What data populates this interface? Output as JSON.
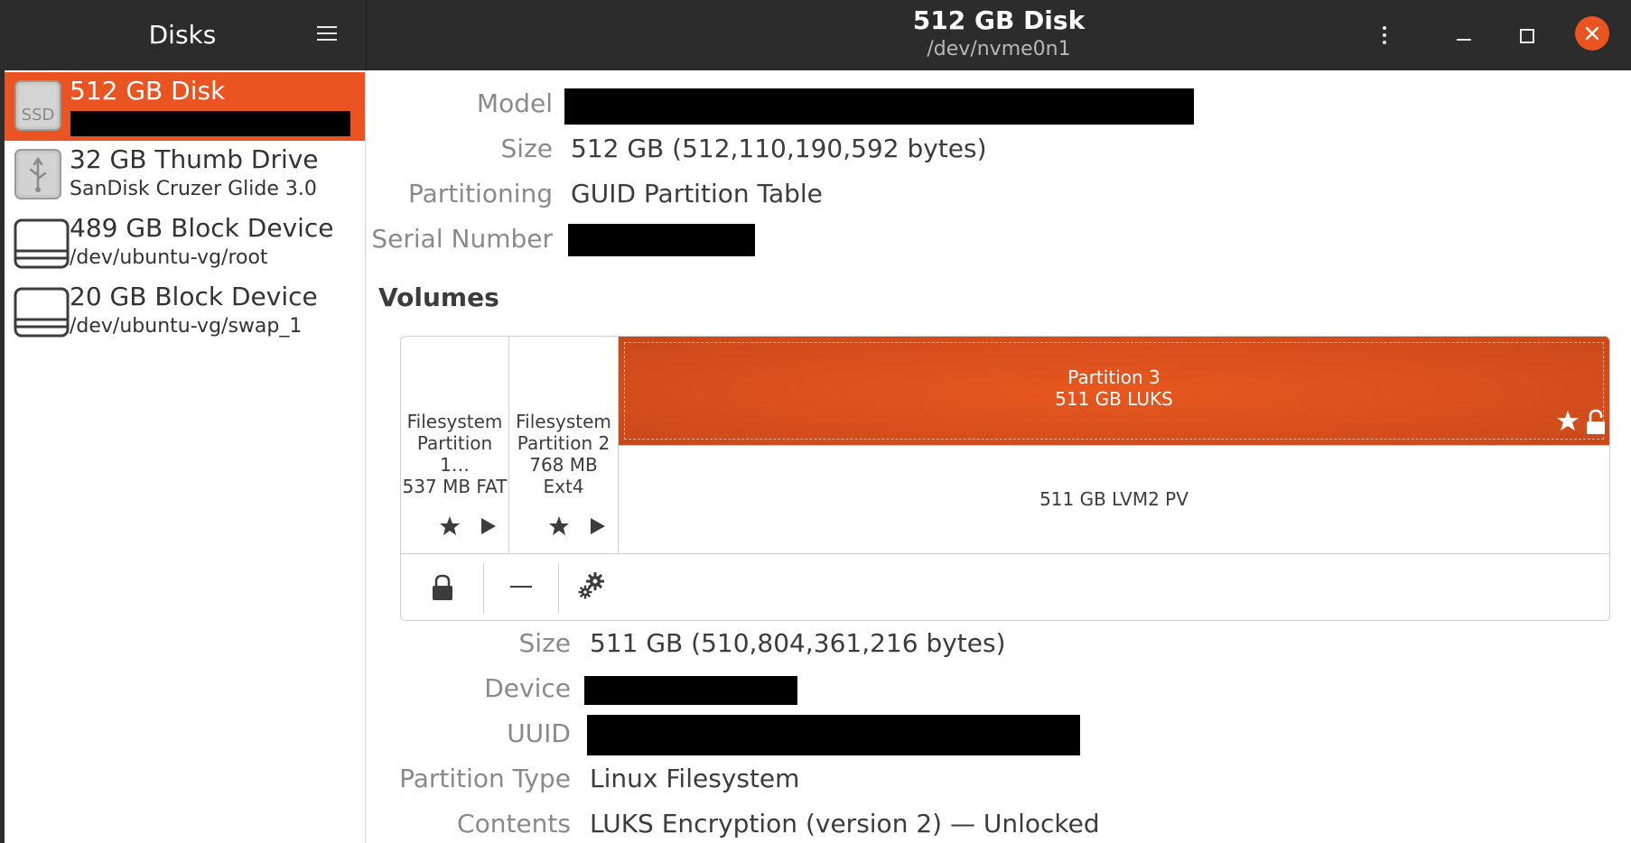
{
  "header": {
    "app_title": "Disks",
    "window_title": "512 GB Disk",
    "window_subtitle": "/dev/nvme0n1"
  },
  "sidebar": {
    "items": [
      {
        "name": "512 GB Disk",
        "subtitle": "",
        "icon": "ssd-icon",
        "icon_label": "SSD",
        "selected": true
      },
      {
        "name": "32 GB Thumb Drive",
        "subtitle": "SanDisk Cruzer Glide 3.0",
        "icon": "usb-drive-icon",
        "selected": false
      },
      {
        "name": "489 GB Block Device",
        "subtitle": "/dev/ubuntu-vg/root",
        "icon": "block-device-icon",
        "selected": false
      },
      {
        "name": "20 GB Block Device",
        "subtitle": "/dev/ubuntu-vg/swap_1",
        "icon": "block-device-icon",
        "selected": false
      }
    ]
  },
  "disk_info": {
    "model_label": "Model",
    "size_label": "Size",
    "size_value": "512 GB (512,110,190,592 bytes)",
    "partitioning_label": "Partitioning",
    "partitioning_value": "GUID Partition Table",
    "serial_label": "Serial Number"
  },
  "volumes": {
    "title": "Volumes",
    "partitions": [
      {
        "line1": "Filesystem",
        "line2": "Partition 1…",
        "line3": "537 MB FAT"
      },
      {
        "line1": "Filesystem",
        "line2": "Partition 2",
        "line3": "768 MB Ext4"
      },
      {
        "line1": "Partition 3",
        "line2": "511 GB LUKS"
      }
    ],
    "inner_volume": "511 GB LVM2 PV",
    "toolbar": [
      "lock-icon",
      "minus-icon",
      "gears-icon"
    ]
  },
  "volume_info": {
    "size_label": "Size",
    "size_value": "511 GB (510,804,361,216 bytes)",
    "device_label": "Device",
    "uuid_label": "UUID",
    "partition_type_label": "Partition Type",
    "partition_type_value": "Linux Filesystem",
    "contents_label": "Contents",
    "contents_value": "LUKS Encryption (version 2) — Unlocked"
  },
  "colors": {
    "accent": "#e95420",
    "headerbar": "#2c2c2c"
  }
}
